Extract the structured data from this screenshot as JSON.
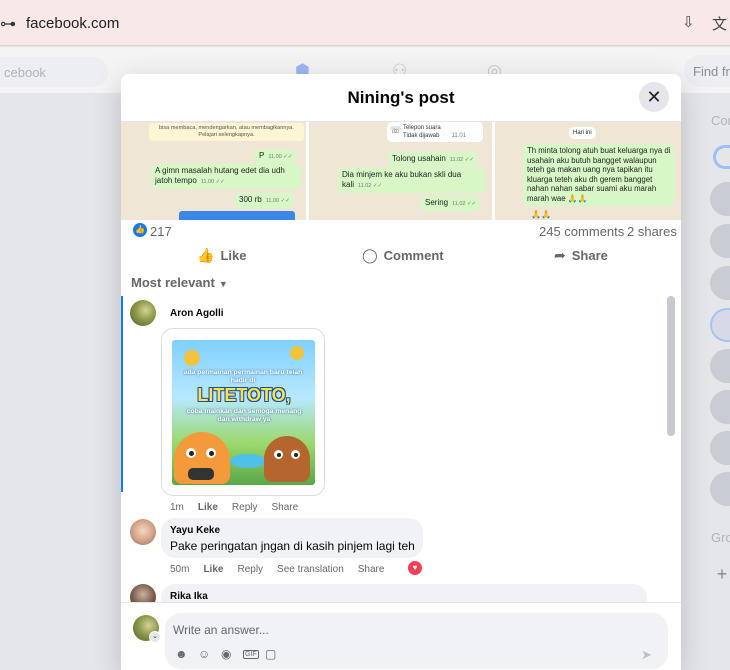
{
  "browser": {
    "url": "facebook.com",
    "tune_icon": "⊶",
    "download_icon": "⇩",
    "translate_icon": "文"
  },
  "fb_background": {
    "search_placeholder": "cebook",
    "find_friends": "Find fri",
    "contacts_heading": "Con",
    "groups_heading": "Gro"
  },
  "modal": {
    "title": "Nining's post",
    "close_icon": "✕"
  },
  "chat_screenshot": {
    "panel1": {
      "notice": "bisa membaca, mendengarkan, atau membagikannya. Pelajari selengkapnya.",
      "messages": [
        {
          "text": "P",
          "time": "11.00 ✓✓"
        },
        {
          "text": "A gimn masalah hutang edet dia udh jatoh tempo",
          "time": "11.00 ✓✓"
        },
        {
          "text": "300 rb",
          "time": "11.00 ✓✓"
        }
      ]
    },
    "panel2": {
      "call_title": "Telepon suara",
      "call_status": "Tidak dijawab",
      "call_time": "11.01",
      "messages": [
        {
          "text": "Tolong usahain",
          "time": "11.02 ✓✓"
        },
        {
          "text": "Dia minjem ke aku bukan skli dua kali",
          "time": "11.02 ✓✓"
        },
        {
          "text": "Sering",
          "time": "11.02 ✓✓"
        }
      ]
    },
    "panel3": {
      "day_label": "Hari ini",
      "message": "Th minta tolong atuh buat keluarga nya di usahain aku butuh bangget walaupun teteh ga makan uang nya tapikan itu kluarga teteh aku dh gerem bangget nahan nahan sabar suami aku marah marah wae 🙏🙏",
      "emoji_row": "🙏🙏"
    }
  },
  "stats": {
    "like_count": "217",
    "comments": "245 comments",
    "shares": "2 shares"
  },
  "actions": {
    "like": "Like",
    "comment": "Comment",
    "share": "Share"
  },
  "sort": {
    "label": "Most relevant"
  },
  "comments": [
    {
      "author": "Aron Agolli",
      "promo": {
        "headline": "ada permainan permainan baru telah hadir di",
        "brand": "LITETOTO,",
        "tagline": "coba mainkan dan semoga menang dan withdraw ya"
      },
      "time": "1m",
      "like": "Like",
      "reply": "Reply",
      "share": "Share"
    },
    {
      "author": "Yayu Keke",
      "text": "Pake peringatan jngan di kasih pinjem lagi teh",
      "time": "50m",
      "like": "Like",
      "reply": "Reply",
      "translation": "See translation",
      "share": "Share"
    },
    {
      "author": "Rika Ika"
    }
  ],
  "composer": {
    "placeholder": "Write an answer...",
    "tools": {
      "avatar_sticker": "☻",
      "emoji": "☺",
      "camera": "◉",
      "gif": "GIF",
      "sticker": "▢"
    },
    "send_icon": "➤"
  },
  "colors": {
    "facebook_blue": "#1877f2",
    "bubble_green": "#d8f7c6",
    "love_red": "#f33e58"
  }
}
